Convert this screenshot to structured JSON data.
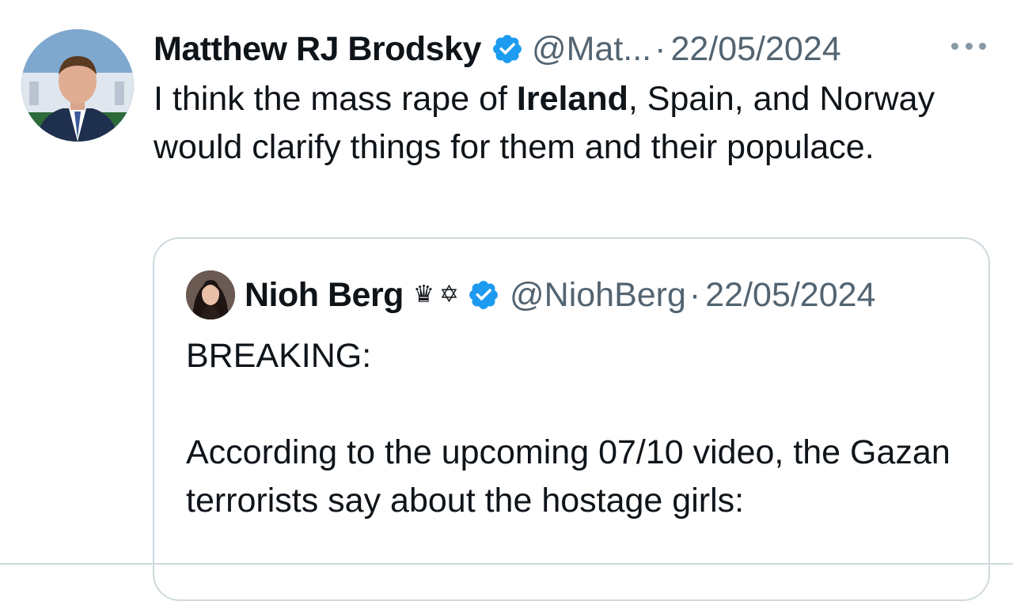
{
  "tweet": {
    "author_name": "Matthew RJ Brodsky",
    "handle": "@Mat...",
    "separator": "·",
    "date": "22/05/2024",
    "text_before": "I think the mass rape of ",
    "text_bold": "Ireland",
    "text_after": ", Spain, and Norway would clarify things for them and their populace.",
    "verified_icon": "verified-badge-icon",
    "more_icon": "more-options-icon"
  },
  "quote": {
    "author_name": "Nioh Berg",
    "emoji_1": "♛",
    "emoji_2": "✡",
    "handle": "@NiohBerg",
    "separator": "·",
    "date": "22/05/2024",
    "text": "BREAKING:\n\nAccording to the upcoming 07/10 video, the Gazan terrorists say about the hostage girls:"
  },
  "colors": {
    "verified": "#1d9bf0",
    "secondary_text": "#536471",
    "border": "#cfd9de"
  }
}
